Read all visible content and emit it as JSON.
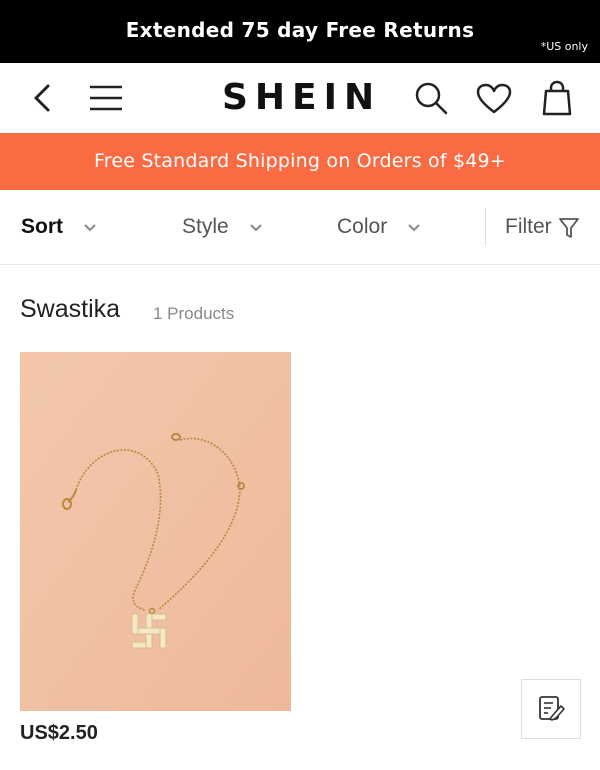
{
  "announcement": {
    "text": "Extended 75 day Free Returns",
    "note": "*US only"
  },
  "header": {
    "logo": "SHEIN",
    "icons": [
      "back-icon",
      "menu-icon",
      "search-icon",
      "heart-icon",
      "bag-icon"
    ]
  },
  "promo": {
    "text": "Free Standard Shipping on Orders of $49+"
  },
  "filters": {
    "sort": "Sort",
    "style": "Style",
    "color": "Color",
    "filter": "Filter"
  },
  "results": {
    "title": "Swastika",
    "count": "1 Products"
  },
  "products": [
    {
      "price": "US$2.50",
      "image": "gold-necklace-pendant"
    }
  ],
  "colors": {
    "promo_bg": "#fa6b44",
    "topbar_bg": "#000000",
    "product_bg": "#f2c2a5"
  }
}
